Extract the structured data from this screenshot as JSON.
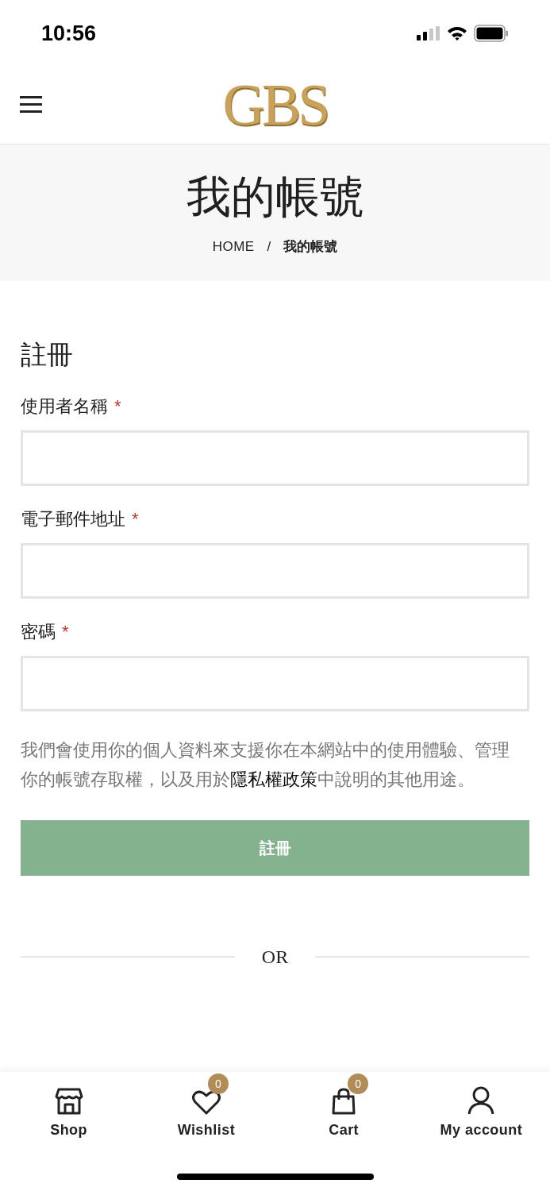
{
  "status_bar": {
    "time": "10:56"
  },
  "header": {
    "logo": "GBS"
  },
  "page_title": {
    "title": "我的帳號",
    "breadcrumb": [
      {
        "label": "HOME"
      },
      {
        "label": "我的帳號"
      }
    ],
    "separator": "/"
  },
  "register": {
    "heading": "註冊",
    "fields": [
      {
        "label": "使用者名稱",
        "required_mark": "*"
      },
      {
        "label": "電子郵件地址",
        "required_mark": "*"
      },
      {
        "label": "密碼",
        "required_mark": "*"
      }
    ],
    "notice": {
      "before": "我們會使用你的個人資料來支援你在本網站中的使用體驗、管理你的帳號存取權，以及用於",
      "link": "隱私權政策",
      "after": "中說明的其他用途。"
    },
    "button": "註冊"
  },
  "divider": {
    "label": "OR"
  },
  "bottom_nav": [
    {
      "kind": "shop",
      "label": "Shop"
    },
    {
      "kind": "wishlist",
      "label": "Wishlist",
      "count": "0"
    },
    {
      "kind": "cart",
      "label": "Cart",
      "count": "0"
    },
    {
      "kind": "account",
      "label": "My account"
    }
  ]
}
